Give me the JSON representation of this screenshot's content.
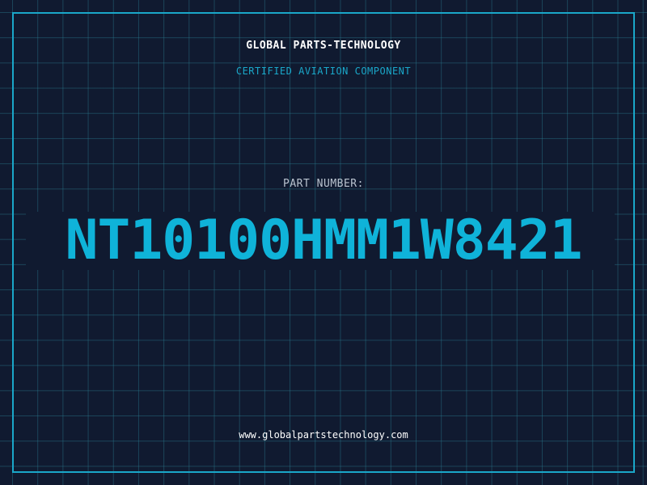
{
  "header": {
    "company": "GLOBAL PARTS-TECHNOLOGY",
    "subtitle": "CERTIFIED AVIATION COMPONENT"
  },
  "part": {
    "label": "PART NUMBER:",
    "number": "NT10100HMM1W8421"
  },
  "footer": {
    "url": "www.globalpartstechnology.com"
  },
  "colors": {
    "background": "#101a30",
    "accent": "#1aa7c9",
    "grid": "#28788c",
    "part_number": "#0fb3d9"
  }
}
